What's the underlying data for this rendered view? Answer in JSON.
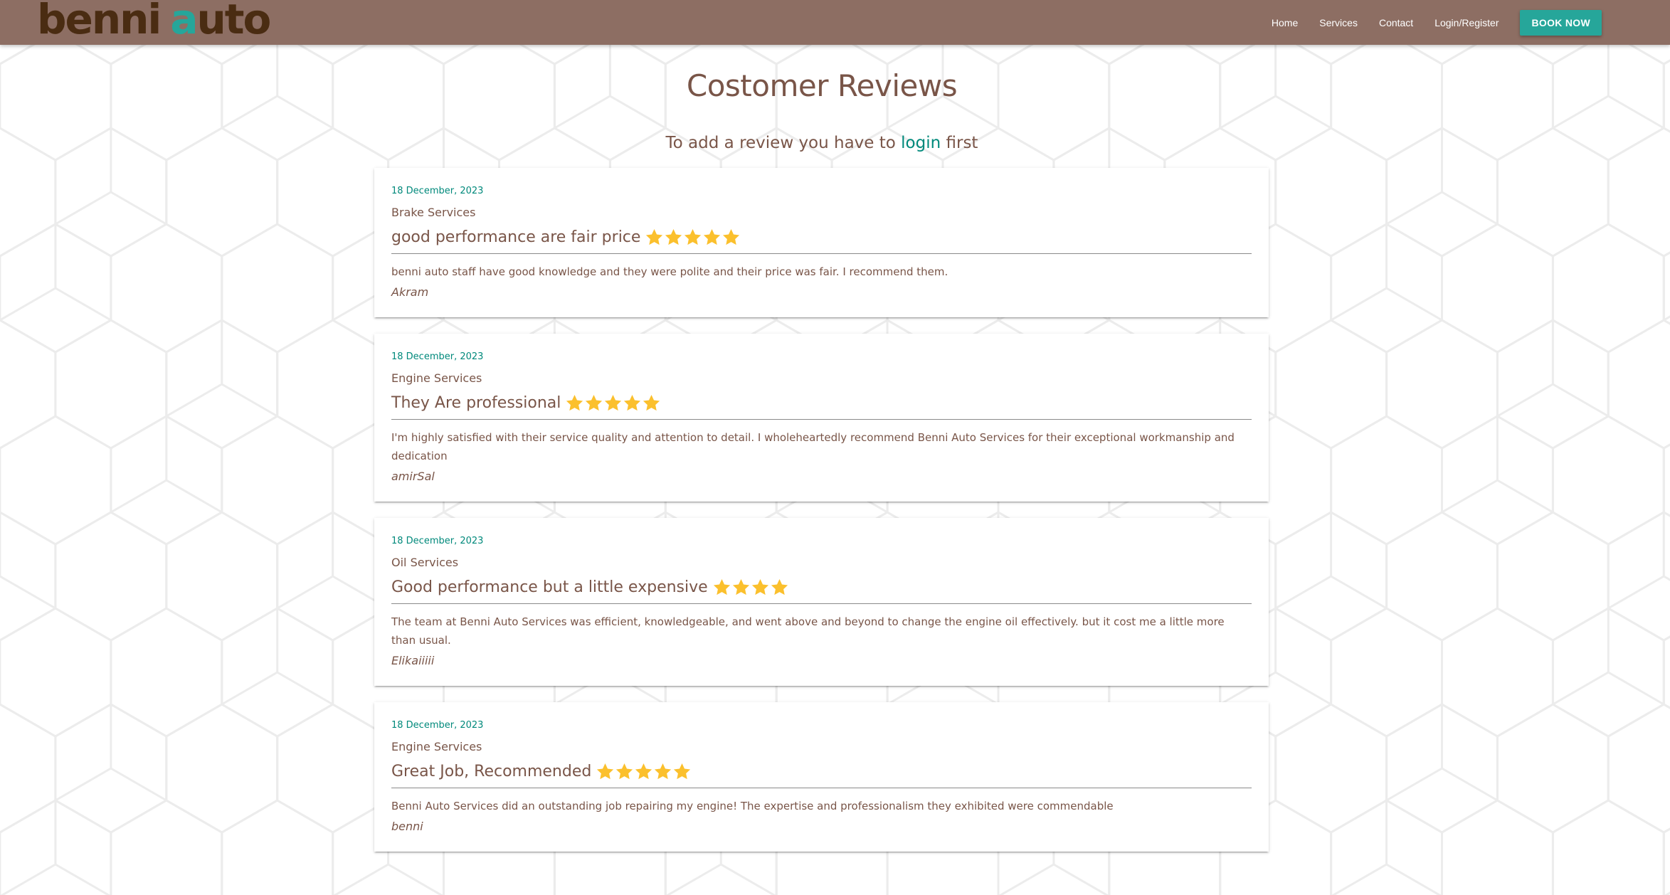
{
  "brand": {
    "logo_part1": "benni",
    "logo_a": "a",
    "logo_part2": "uto",
    "logo_alt": "benni auto"
  },
  "nav": {
    "items": [
      {
        "label": "Home"
      },
      {
        "label": "Services"
      },
      {
        "label": "Contact"
      },
      {
        "label": "Login/Register"
      }
    ],
    "cta_label": "BOOK NOW"
  },
  "page": {
    "title": "Costomer Reviews",
    "prompt_before": "To add a review you have to ",
    "prompt_link": "login",
    "prompt_after": " first"
  },
  "reviews": [
    {
      "date": "18 December, 2023",
      "service": "Brake Services",
      "title": "good performance are fair price",
      "rating": 5,
      "body": "benni auto staff have good knowledge and they were polite and their price was fair. I recommend them.",
      "author": "Akram"
    },
    {
      "date": "18 December, 2023",
      "service": "Engine Services",
      "title": "They Are professional",
      "rating": 5,
      "body": "I'm highly satisfied with their service quality and attention to detail. I wholeheartedly recommend Benni Auto Services for their exceptional workmanship and dedication",
      "author": "amirSal"
    },
    {
      "date": "18 December, 2023",
      "service": "Oil Services",
      "title": "Good performance but a little expensive",
      "rating": 4,
      "body": "The team at Benni Auto Services was efficient, knowledgeable, and went above and beyond to change the engine oil effectively. but it cost me a little more than usual.",
      "author": "Elikaiiiii"
    },
    {
      "date": "18 December, 2023",
      "service": "Engine Services",
      "title": "Great Job, Recommended",
      "rating": 5,
      "body": "Benni Auto Services did an outstanding job repairing my engine! The expertise and professionalism they exhibited were commendable",
      "author": "benni"
    }
  ],
  "colors": {
    "navbar": "#8d6e63",
    "accent": "#26a69a",
    "text_brown": "#795548",
    "star": "#fbc02d",
    "logo_dark": "#4a2c12"
  },
  "icons": {
    "rating": "star-icon"
  }
}
